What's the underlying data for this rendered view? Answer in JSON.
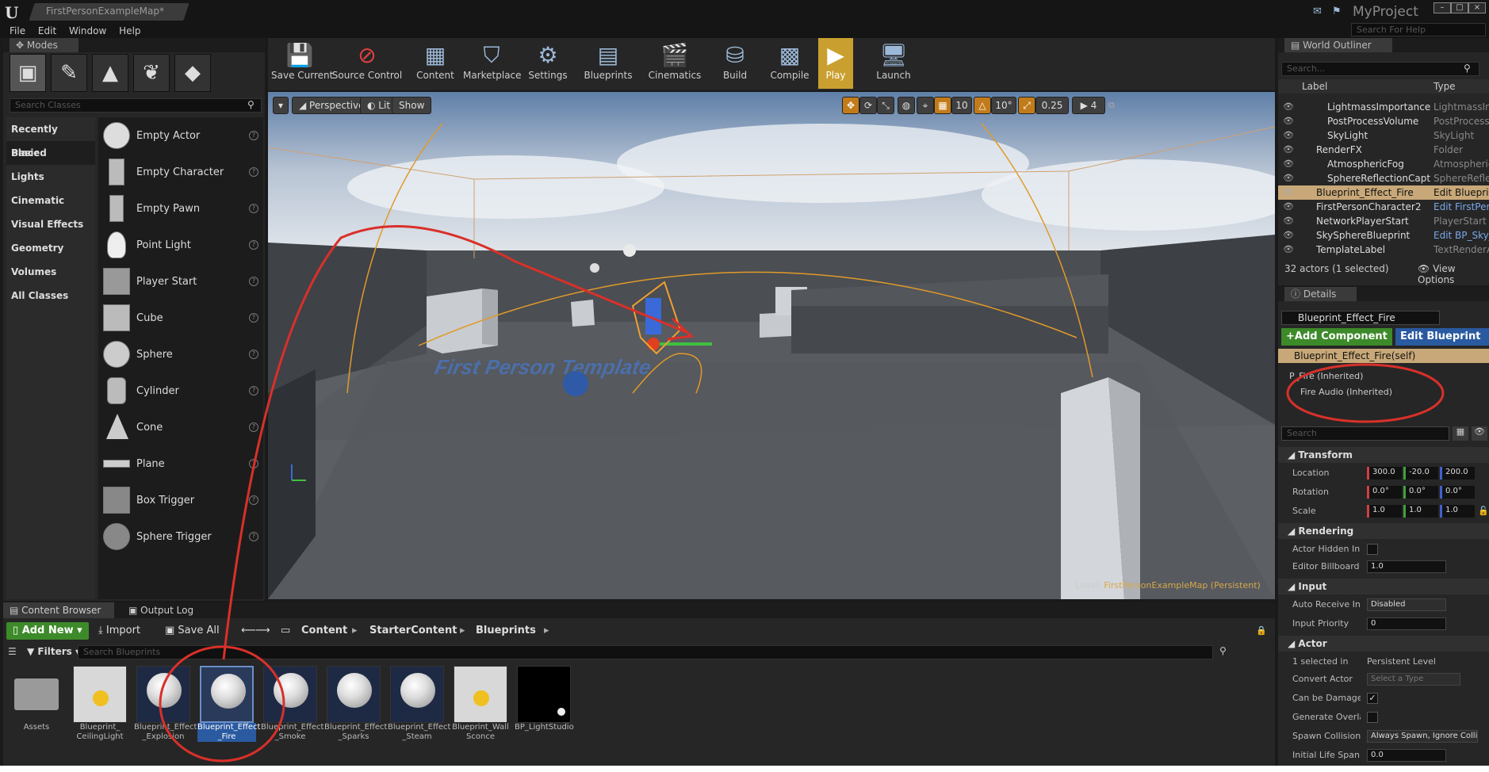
{
  "window": {
    "tab_title": "FirstPersonExampleMap*",
    "project": "MyProject",
    "help_search_placeholder": "Search For Help"
  },
  "menu": [
    "File",
    "Edit",
    "Window",
    "Help"
  ],
  "modes": {
    "tab": "Modes",
    "search_placeholder": "Search Classes",
    "categories": [
      "Recently Placed",
      "Basic",
      "Lights",
      "Cinematic",
      "Visual Effects",
      "Geometry",
      "Volumes",
      "All Classes"
    ],
    "selected_category": "Basic",
    "classes": [
      "Empty Actor",
      "Empty Character",
      "Empty Pawn",
      "Point Light",
      "Player Start",
      "Cube",
      "Sphere",
      "Cylinder",
      "Cone",
      "Plane",
      "Box Trigger",
      "Sphere Trigger"
    ]
  },
  "toolbar": {
    "save_current": "Save Current",
    "source_control": "Source Control",
    "content": "Content",
    "marketplace": "Marketplace",
    "settings": "Settings",
    "blueprints": "Blueprints",
    "cinematics": "Cinematics",
    "build": "Build",
    "compile": "Compile",
    "play": "Play",
    "launch": "Launch"
  },
  "viewport": {
    "perspective": "Perspective",
    "lit": "Lit",
    "show": "Show",
    "grid_snap": "10",
    "rotation_snap": "10°",
    "scale_snap": "0.25",
    "camera_speed": "4",
    "floor_text": "First Person Template",
    "level_label": "Level:",
    "level_name": "FirstPersonExampleMap (Persistent)"
  },
  "outliner": {
    "tab": "World Outliner",
    "search_placeholder": "Search...",
    "col_label": "Label",
    "col_type": "Type",
    "rows": [
      {
        "label": "LightmassImportanceVolume",
        "type": "LightmassImportanceVolume",
        "link": false,
        "indent": 2
      },
      {
        "label": "PostProcessVolume",
        "type": "PostProcessVolume",
        "link": false,
        "indent": 2
      },
      {
        "label": "SkyLight",
        "type": "SkyLight",
        "link": false,
        "indent": 2
      },
      {
        "label": "RenderFX",
        "type": "Folder",
        "link": false,
        "indent": 1
      },
      {
        "label": "AtmosphericFog",
        "type": "AtmosphericFog",
        "link": false,
        "indent": 2
      },
      {
        "label": "SphereReflectionCapture",
        "type": "SphereReflectionCapture",
        "link": false,
        "indent": 2
      },
      {
        "label": "Blueprint_Effect_Fire",
        "type": "Edit Blueprint_Effect_Fire",
        "link": true,
        "indent": 1
      },
      {
        "label": "FirstPersonCharacter2",
        "type": "Edit FirstPersonCharacter",
        "link": true,
        "indent": 1
      },
      {
        "label": "NetworkPlayerStart",
        "type": "PlayerStart",
        "link": false,
        "indent": 1
      },
      {
        "label": "SkySphereBlueprint",
        "type": "Edit BP_Sky_Sphere",
        "link": true,
        "indent": 1
      },
      {
        "label": "TemplateLabel",
        "type": "TextRenderActor",
        "link": false,
        "indent": 1
      }
    ],
    "selected_index": 6,
    "actor_count": "32 actors (1 selected)",
    "view_options": "View Options"
  },
  "details": {
    "tab": "Details",
    "actor_name": "Blueprint_Effect_Fire",
    "add_component": "+Add Component",
    "edit_blueprint": "Edit Blueprint",
    "self_component": "Blueprint_Effect_Fire(self)",
    "fire_component": "P_Fire (Inherited)",
    "fire_audio_component": "Fire Audio (Inherited)",
    "search_placeholder": "Search",
    "sections": {
      "transform": "Transform",
      "rendering": "Rendering",
      "input": "Input",
      "actor": "Actor"
    },
    "location_label": "Location",
    "location": [
      "300.0",
      "-20.0",
      "200.0"
    ],
    "rotation_label": "Rotation",
    "rotation": [
      "0.0°",
      "0.0°",
      "0.0°"
    ],
    "scale_label": "Scale",
    "scale": [
      "1.0",
      "1.0",
      "1.0"
    ],
    "actor_hidden_label": "Actor Hidden In",
    "editor_billboard_label": "Editor Billboard",
    "editor_billboard": "1.0",
    "auto_receive_label": "Auto Receive In",
    "auto_receive": "Disabled",
    "input_priority_label": "Input Priority",
    "input_priority": "0",
    "selected_in_label": "1 selected in",
    "selected_in": "Persistent Level",
    "convert_actor_label": "Convert Actor",
    "convert_actor": "Select a Type",
    "can_be_damaged_label": "Can be Damage",
    "generate_overlap_label": "Generate Overla",
    "spawn_collision_label": "Spawn Collision",
    "spawn_collision": "Always Spawn, Ignore Colli",
    "initial_life_label": "Initial Life Span",
    "initial_life": "0.0"
  },
  "content_browser": {
    "tab": "Content Browser",
    "output_tab": "Output Log",
    "add_new": "Add New",
    "import": "Import",
    "save_all": "Save All",
    "path": [
      "Content",
      "StarterContent",
      "Blueprints"
    ],
    "filters": "Filters",
    "search_placeholder": "Search Blueprints",
    "assets": [
      {
        "label": "Assets",
        "kind": "folder"
      },
      {
        "label": "Blueprint_ CeilingLight",
        "kind": "light"
      },
      {
        "label": "Blueprint_Effect _Explosion",
        "kind": "sphere"
      },
      {
        "label": "Blueprint_Effect _Fire",
        "kind": "sphere"
      },
      {
        "label": "Blueprint_Effect _Smoke",
        "kind": "sphere"
      },
      {
        "label": "Blueprint_Effect _Sparks",
        "kind": "sphere"
      },
      {
        "label": "Blueprint_Effect _Steam",
        "kind": "sphere"
      },
      {
        "label": "Blueprint_Wall Sconce",
        "kind": "sconce"
      },
      {
        "label": "BP_LightStudio",
        "kind": "dark"
      }
    ],
    "selected_asset": 3
  },
  "colors": {
    "accent_green": "#3d8a2a",
    "play_yellow": "#c9a030",
    "selection": "#c8a878",
    "annotation_red": "#d9302a"
  }
}
